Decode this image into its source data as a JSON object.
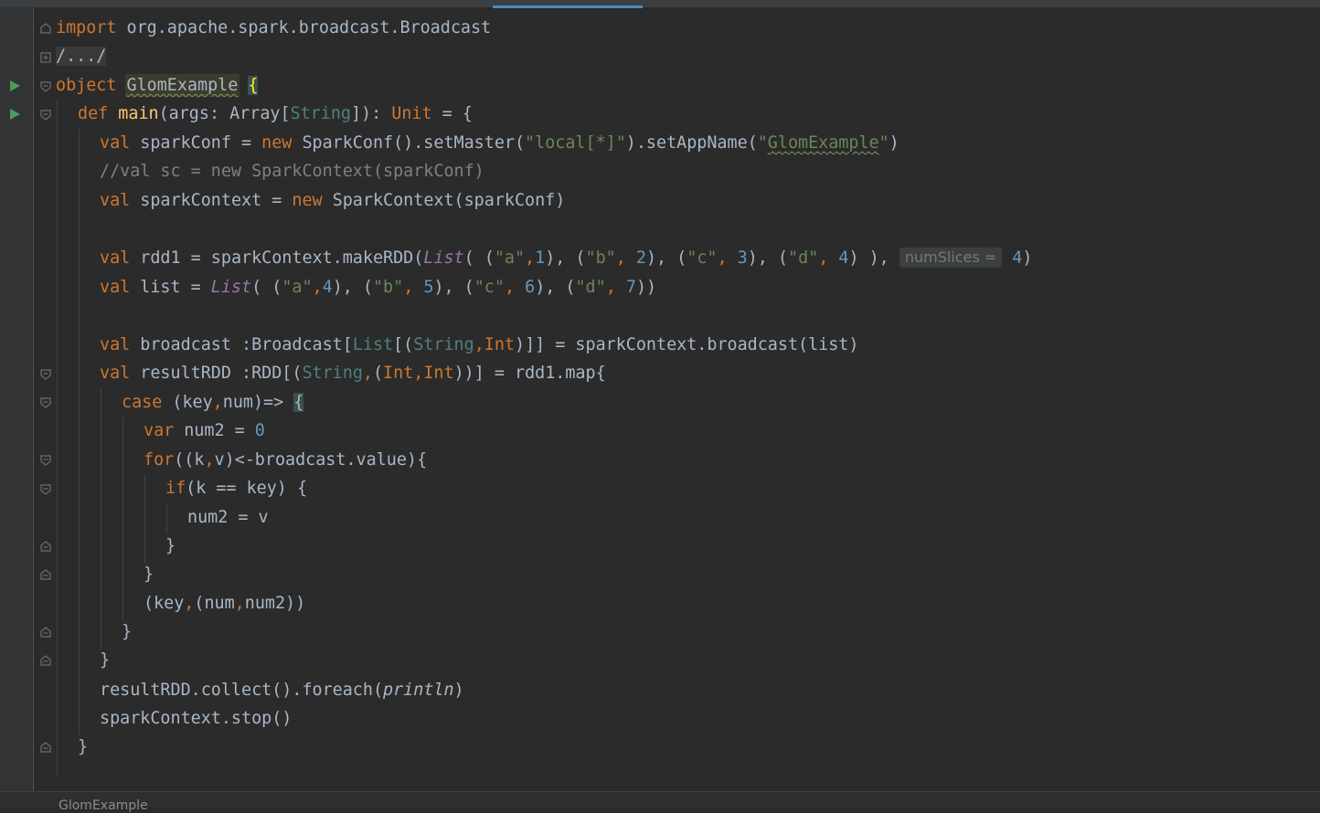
{
  "editor": {
    "file_name": "GlomExample",
    "breadcrumb": "GlomExample",
    "lines": {
      "l1": {
        "kw": "import",
        "rest": " org.apache.spark.broadcast.Broadcast"
      },
      "l2": {
        "collapsed": "/.../"
      },
      "l3": {
        "kw": "object",
        "name": "GlomExample",
        "brace": "{"
      },
      "l4": {
        "kw": "def",
        "fn": "main",
        "p1": "(args: Array[",
        "t1": "String",
        "p2": "]): ",
        "t2": "Unit",
        "p3": " = {"
      },
      "l5": {
        "kw1": "val",
        "p1": " sparkConf = ",
        "kw2": "new",
        "p2": " SparkConf().setMaster(",
        "s1": "\"local[*]\"",
        "p3": ").setAppName(",
        "s2a": "\"",
        "s2b": "GlomExample",
        "s2c": "\"",
        "p4": ")"
      },
      "l6": {
        "comment": "//val sc = new SparkContext(sparkConf)"
      },
      "l7": {
        "kw1": "val",
        "p1": " sparkContext = ",
        "kw2": "new",
        "p2": " SparkContext(sparkConf)"
      },
      "l8": {
        "kw": "val",
        "p1": " rdd1 = sparkContext.makeRDD(",
        "list": "List",
        "p2": "( (",
        "s_a": "\"a\"",
        "c1": ",",
        "n1": "1",
        "p3": "), (",
        "s_b": "\"b\"",
        "c2": ", ",
        "n2": "2",
        "p4": "), (",
        "s_c": "\"c\"",
        "c3": ", ",
        "n3": "3",
        "p5": "), (",
        "s_d": "\"d\"",
        "c4": ", ",
        "n4": "4",
        "p6": ") ), ",
        "hint": "numSlices =",
        "n5": "4",
        "p7": ")"
      },
      "l9": {
        "kw": "val",
        "p1": " list = ",
        "list": "List",
        "p2": "( (",
        "s_a": "\"a\"",
        "c1": ",",
        "n1": "4",
        "p3": "), (",
        "s_b": "\"b\"",
        "c2": ", ",
        "n2": "5",
        "p4": "), (",
        "s_c": "\"c\"",
        "c3": ", ",
        "n3": "6",
        "p5": "), (",
        "s_d": "\"d\"",
        "c4": ", ",
        "n4": "7",
        "p6": "))"
      },
      "l10": {
        "kw": "val",
        "p1": " broadcast :Broadcast[",
        "t1": "List",
        "p2": "[(",
        "t2": "String",
        "c1": ",",
        "t3": "Int",
        "p3": ")]] = sparkContext.broadcast(list)"
      },
      "l11": {
        "kw": "val",
        "p1": " resultRDD :RDD[(",
        "t1": "String",
        "c1": ",",
        "p2": "(",
        "t2": "Int",
        "c2": ",",
        "t3": "Int",
        "p3": "))] = rdd1.map{"
      },
      "l12": {
        "kw": "case",
        "p1": " (key",
        "c1": ",",
        "p2": "num)=> ",
        "brace": "{"
      },
      "l13": {
        "kw": "var",
        "p1": " num2 = ",
        "n1": "0"
      },
      "l14": {
        "kw": "for",
        "p1": "((k",
        "c1": ",",
        "p2": "v)<-broadcast.value){"
      },
      "l15": {
        "kw": "if",
        "p1": "(k == key) {"
      },
      "l16": {
        "p1": "num2 = v"
      },
      "l17": {
        "p1": "}"
      },
      "l18": {
        "p1": "}"
      },
      "l19": {
        "p1": "(key",
        "c1": ",",
        "p2": "(num",
        "c2": ",",
        "p3": "num2))"
      },
      "l20": {
        "p1": "}"
      },
      "l21": {
        "p1": "}"
      },
      "l22": {
        "p1": "resultRDD.collect().foreach(",
        "ital": "println",
        "p2": ")"
      },
      "l23": {
        "p1": "sparkContext.stop()"
      },
      "l24": {
        "p1": "}"
      }
    }
  },
  "colors": {
    "background": "#2b2b2b",
    "keyword": "#cc7832",
    "string": "#6a8759",
    "number": "#6897bb",
    "comment": "#808080",
    "type": "#4e807d",
    "function": "#ffc66d",
    "run_icon": "#499c54"
  },
  "icons": {
    "run": "play-triangle-icon",
    "fold": "fold-marker-icon",
    "expand": "expand-plus-icon"
  }
}
